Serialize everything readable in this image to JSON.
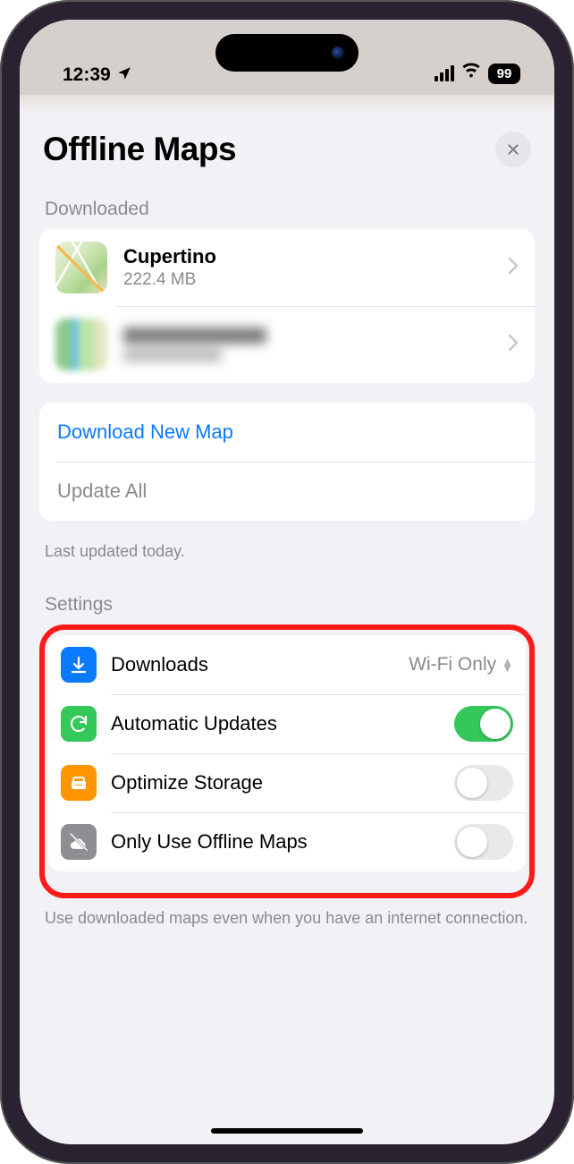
{
  "status": {
    "time": "12:39",
    "battery": "99"
  },
  "header": {
    "title": "Offline Maps"
  },
  "downloaded": {
    "header": "Downloaded",
    "items": [
      {
        "title": "Cupertino",
        "size": "222.4 MB",
        "redacted": false
      },
      {
        "title": "",
        "size": "",
        "redacted": true
      }
    ]
  },
  "actions": {
    "download_new": "Download New Map",
    "update_all": "Update All",
    "last_updated": "Last updated today."
  },
  "settings": {
    "header": "Settings",
    "downloads_label": "Downloads",
    "downloads_value": "Wi-Fi Only",
    "auto_updates_label": "Automatic Updates",
    "auto_updates_on": true,
    "optimize_label": "Optimize Storage",
    "optimize_on": false,
    "offline_only_label": "Only Use Offline Maps",
    "offline_only_on": false,
    "footer": "Use downloaded maps even when you have an internet connection."
  }
}
